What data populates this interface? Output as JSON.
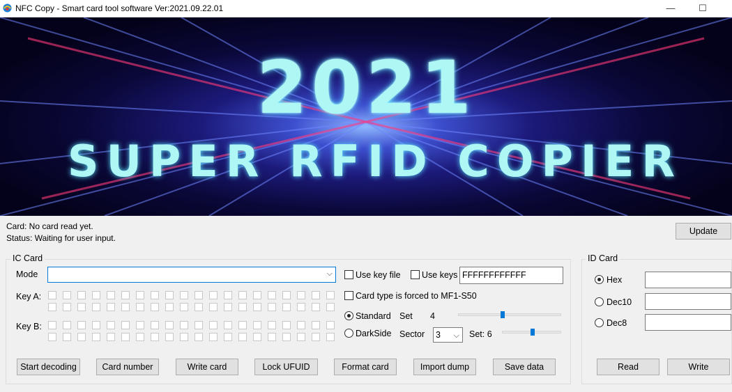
{
  "window": {
    "title": "NFC Copy - Smart card tool software  Ver:2021.09.22.01",
    "minimize": "—",
    "maximize": "☐"
  },
  "banner": {
    "year": "2021",
    "subtitle": "SUPER RFID COPIER"
  },
  "status": {
    "card": "Card: No card read yet.",
    "status": "Status: Waiting for user input.",
    "update_label": "Update"
  },
  "ic_card": {
    "legend": "IC Card",
    "mode_label": "Mode",
    "mode_value": "",
    "use_key_file_label": "Use key file",
    "use_keys_label": "Use keys",
    "use_keys_value": "FFFFFFFFFFFF",
    "card_type_forced_label": "Card type is forced to MF1-S50",
    "key_a_label": "Key A:",
    "key_b_label": "Key B:",
    "standard_label": "Standard",
    "darkside_label": "DarkSide",
    "set_label": "Set",
    "set_value": "4",
    "sector_label": "Sector",
    "sector_value": "3",
    "set_readout": "Set: 6",
    "mode_selected": "Standard"
  },
  "actions": {
    "start_decoding": "Start decoding",
    "card_number": "Card number",
    "write_card": "Write card",
    "lock_ufuid": "Lock UFUID",
    "format_card": "Format card",
    "import_dump": "Import dump",
    "save_data": "Save data"
  },
  "id_card": {
    "legend": "ID Card",
    "hex_label": "Hex",
    "dec10_label": "Dec10",
    "dec8_label": "Dec8",
    "selected": "Hex",
    "read_label": "Read",
    "write_label": "Write"
  }
}
